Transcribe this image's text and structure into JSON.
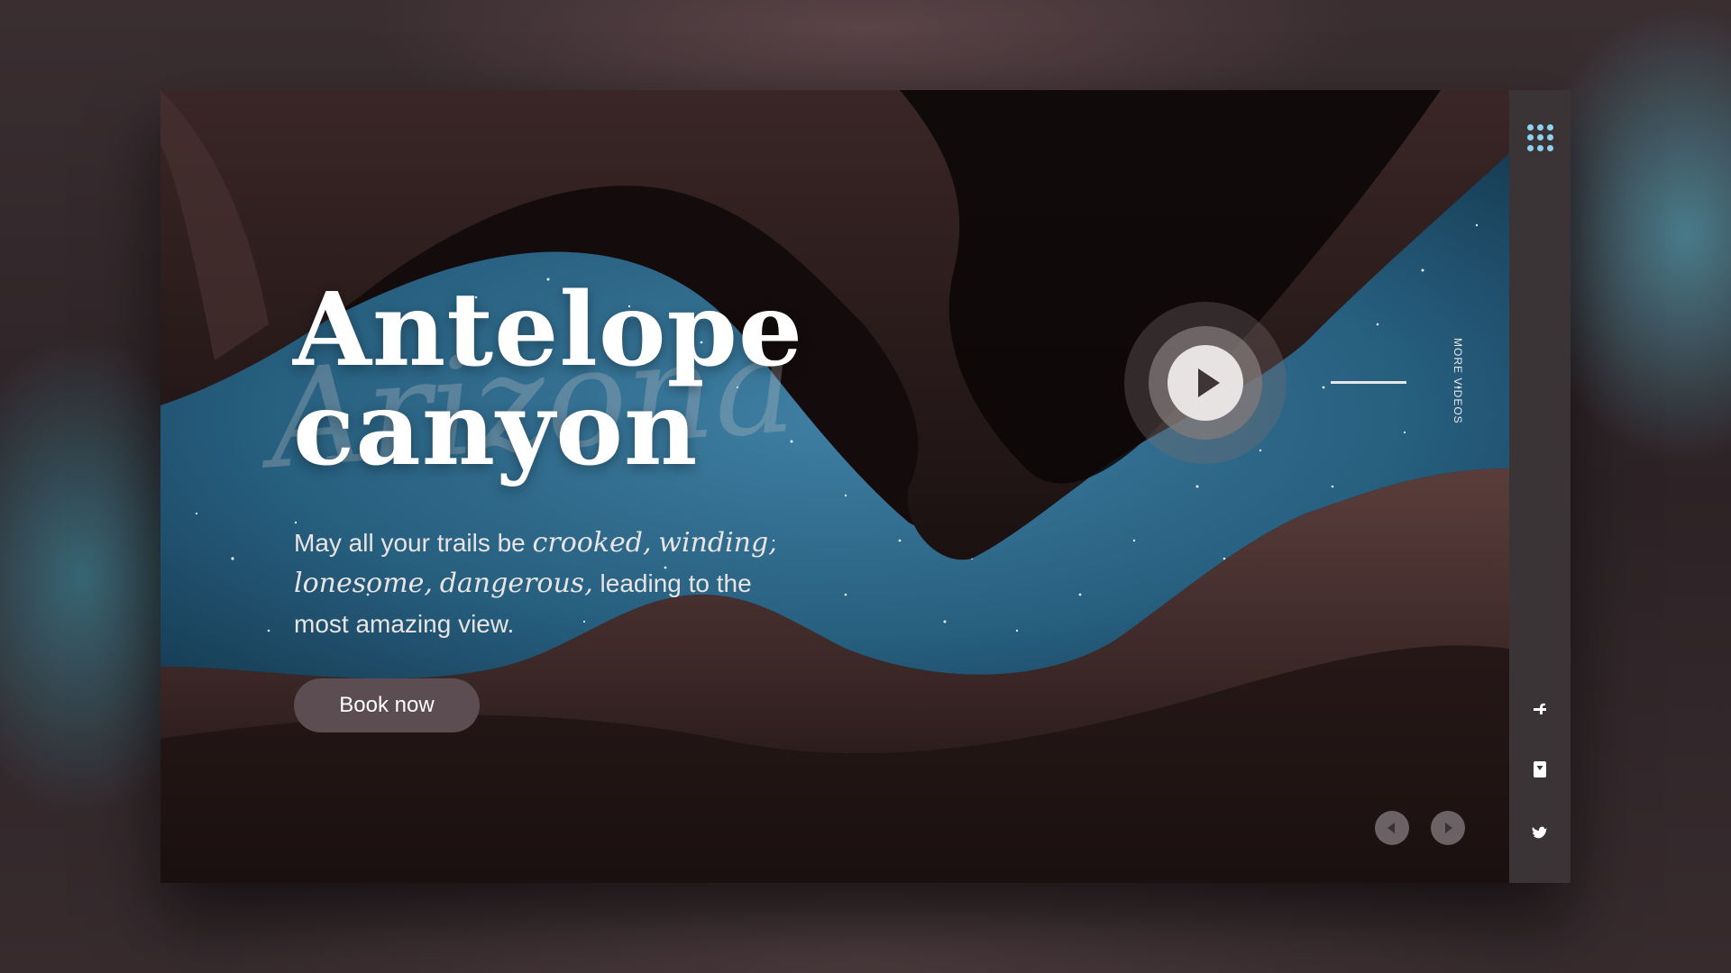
{
  "hero": {
    "title_line1": "Antelope",
    "title_line2": "canyon",
    "watermark": "Arizona",
    "tagline": {
      "intro": "May all your trails be ",
      "word1": "crooked,",
      "word2": "winding,",
      "word3": "lonesome,",
      "word4": "dangerous,",
      "outro": " leading to the most amazing view."
    },
    "cta_label": "Book now"
  },
  "video": {
    "more_videos_label": "MORE VIDEOS"
  },
  "sidebar": {
    "icons": [
      "apps-grid-icon",
      "facebook-icon",
      "instagram-icon",
      "twitter-icon"
    ]
  },
  "colors": {
    "accent": "#8fd1f0",
    "sidebar": "#3b3437",
    "cta": "#5b4d51"
  }
}
